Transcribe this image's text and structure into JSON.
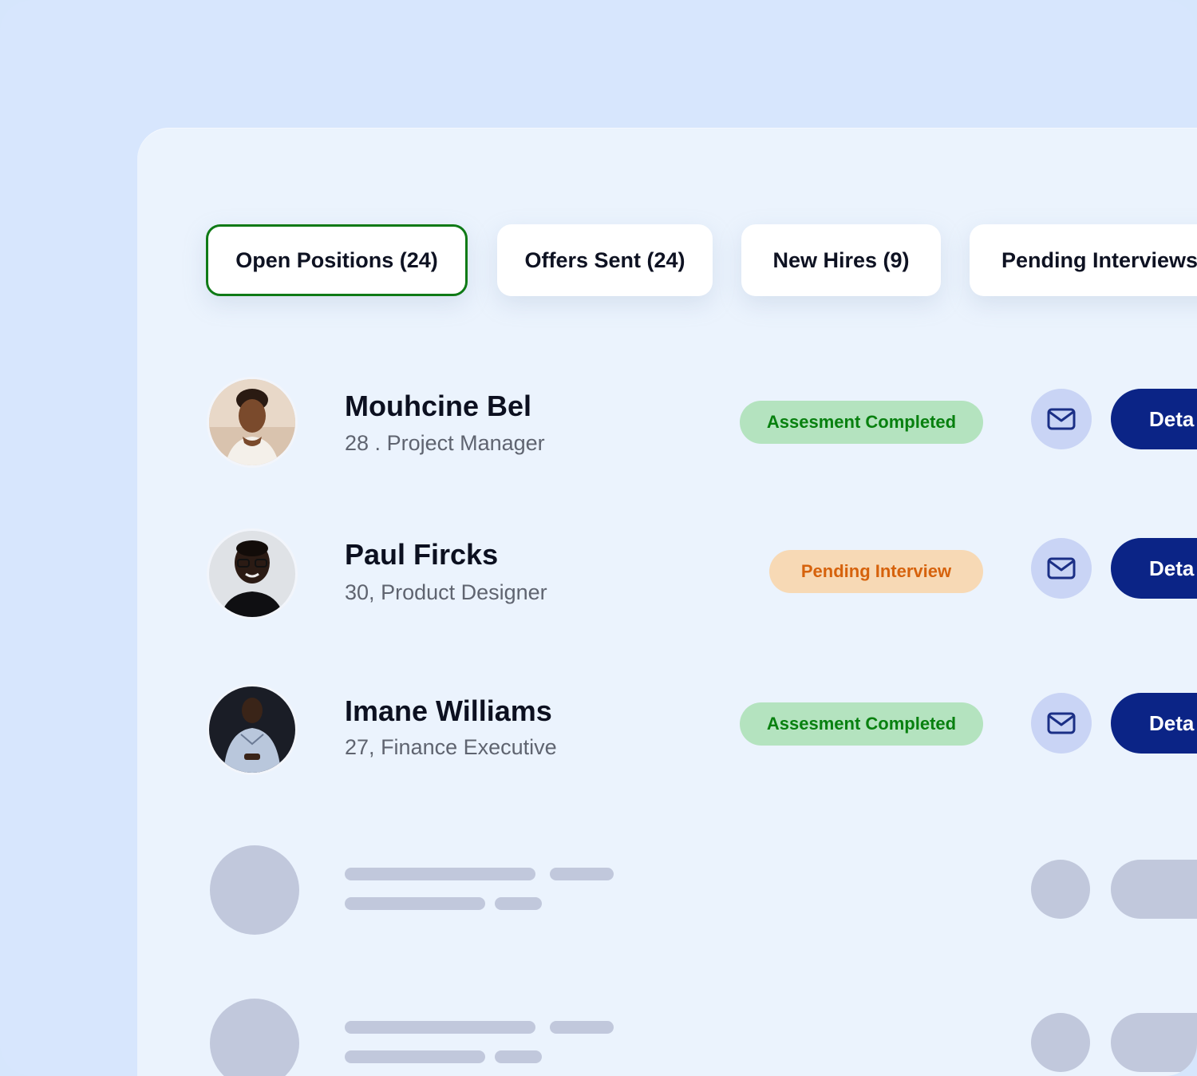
{
  "tabs": [
    {
      "label": "Open Positions (24)",
      "active": true
    },
    {
      "label": "Offers Sent (24)",
      "active": false
    },
    {
      "label": "New Hires (9)",
      "active": false
    },
    {
      "label": "Pending Interviews",
      "active": false
    }
  ],
  "candidates": [
    {
      "name": "Mouhcine Bel",
      "age": "28 .",
      "role": "Project Manager",
      "status": "Assesment Completed",
      "status_color": "#08800f",
      "action": "Deta"
    },
    {
      "name": "Paul Fircks",
      "age": "30,",
      "role": "Product Designer",
      "status": "Pending Interview",
      "status_color": "#d6620c",
      "action": "Deta"
    },
    {
      "name": "Imane Williams",
      "age": "27,",
      "role": "Finance Executive",
      "status": "Assesment Completed",
      "status_color": "#08800f",
      "action": "Deta"
    }
  ],
  "icons": {
    "mail": "mail-icon"
  },
  "colors": {
    "active_tab_border": "#0f7a16",
    "primary_button": "#0b2486",
    "skeleton": "#c1c8dc"
  }
}
